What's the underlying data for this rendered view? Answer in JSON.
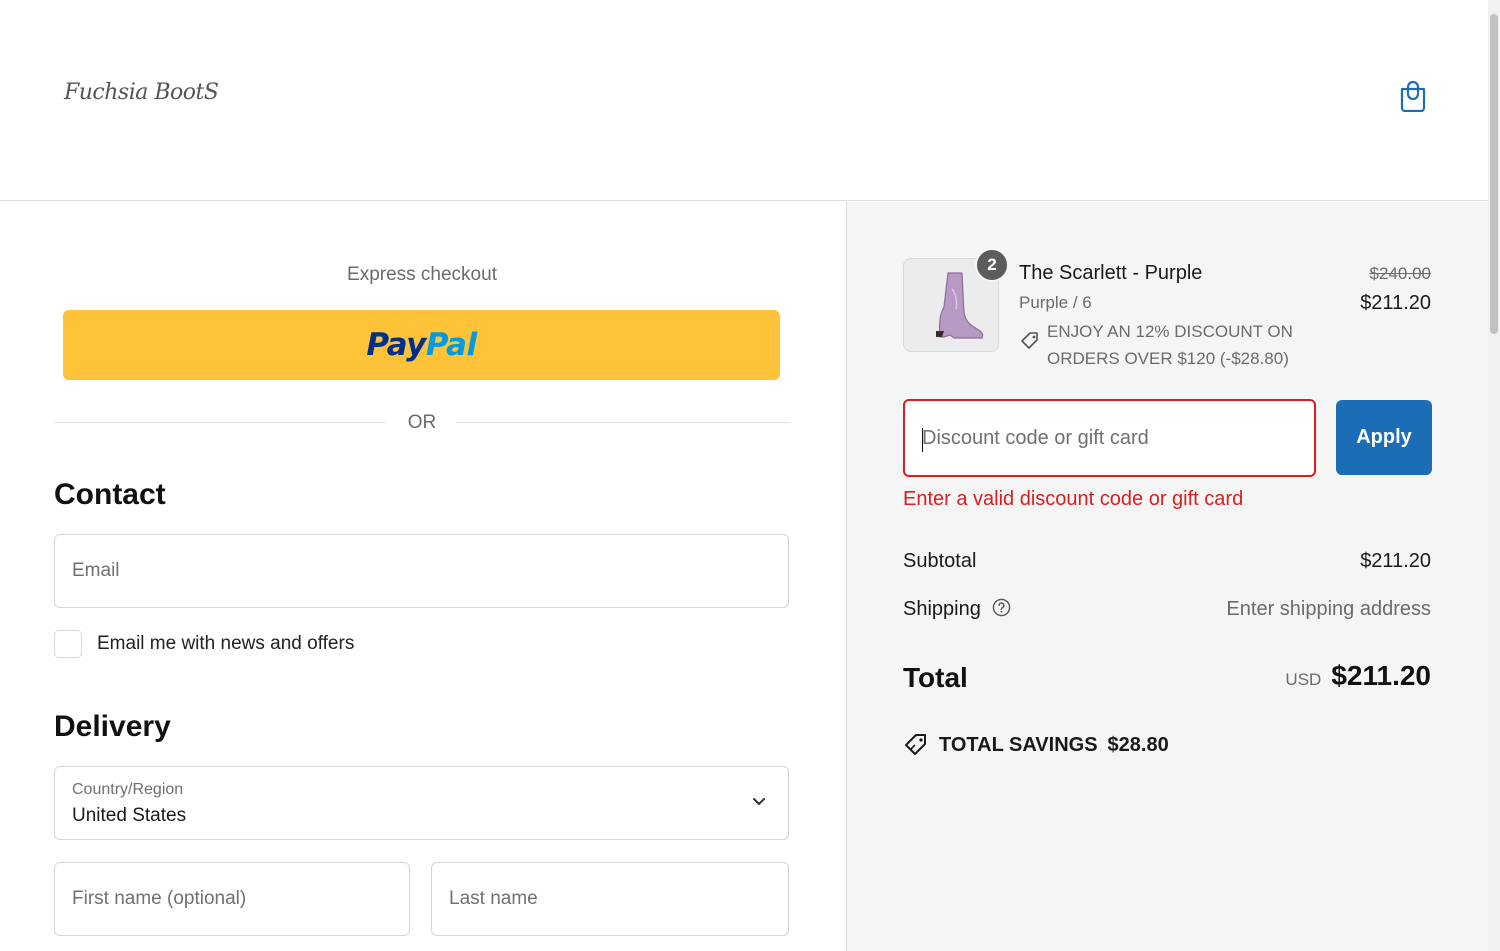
{
  "header": {
    "logo_text": "Fuchsia BootS",
    "cart_icon": "shopping-bag-icon"
  },
  "express": {
    "title": "Express checkout",
    "paypal_pay": "Pay",
    "paypal_pal": "Pal",
    "divider": "OR"
  },
  "contact": {
    "heading": "Contact",
    "email_placeholder": "Email",
    "newsletter_label": "Email me with news and offers"
  },
  "delivery": {
    "heading": "Delivery",
    "country_label": "Country/Region",
    "country_value": "United States",
    "first_name_placeholder": "First name (optional)",
    "last_name_placeholder": "Last name"
  },
  "order": {
    "item": {
      "quantity": "2",
      "name": "The Scarlett - Purple",
      "variant": "Purple / 6",
      "discount_note": "ENJOY AN 12% DISCOUNT ON ORDERS OVER $120 (-$28.80)",
      "price_original": "$240.00",
      "price_final": "$211.20"
    },
    "discount": {
      "placeholder": "Discount code or gift card",
      "apply_label": "Apply",
      "error": "Enter a valid discount code or gift card"
    },
    "subtotal_label": "Subtotal",
    "subtotal_value": "$211.20",
    "shipping_label": "Shipping",
    "shipping_value": "Enter shipping address",
    "total_label": "Total",
    "currency": "USD",
    "total_value": "$211.20",
    "savings_label": "TOTAL SAVINGS",
    "savings_value": "$28.80"
  },
  "colors": {
    "paypal_yellow": "#fec339",
    "apply_blue": "#1b6eb5",
    "error_red": "#dd1d1d",
    "summary_bg": "#f5f5f5"
  }
}
